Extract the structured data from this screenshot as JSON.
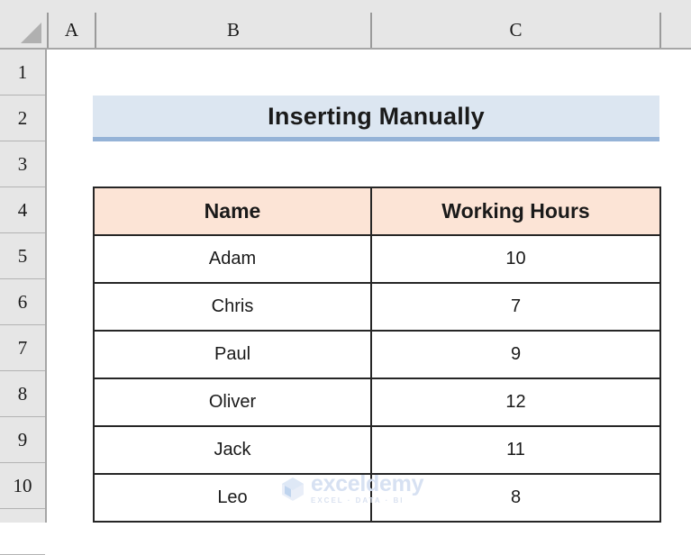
{
  "app": {
    "type": "spreadsheet",
    "select_all_icon": "select-all-triangle-icon"
  },
  "grid": {
    "column_headers": [
      "A",
      "B",
      "C"
    ],
    "row_headers": [
      "1",
      "2",
      "3",
      "4",
      "5",
      "6",
      "7",
      "8",
      "9",
      "10"
    ]
  },
  "title_banner": {
    "text": "Inserting Manually",
    "fill_color": "#dce6f1",
    "underline_color": "#95b3d7"
  },
  "table": {
    "header_fill": "#fce4d6",
    "border_color": "#262626",
    "columns": [
      "Name",
      "Working Hours"
    ],
    "rows": [
      {
        "name": "Adam",
        "hours": "10"
      },
      {
        "name": "Chris",
        "hours": "7"
      },
      {
        "name": "Paul",
        "hours": "9"
      },
      {
        "name": "Oliver",
        "hours": "12"
      },
      {
        "name": "Jack",
        "hours": "11"
      },
      {
        "name": "Leo",
        "hours": "8"
      }
    ]
  },
  "watermark": {
    "word": "exceldemy",
    "tagline": "EXCEL · DATA · BI",
    "color": "#d5e0f2"
  }
}
